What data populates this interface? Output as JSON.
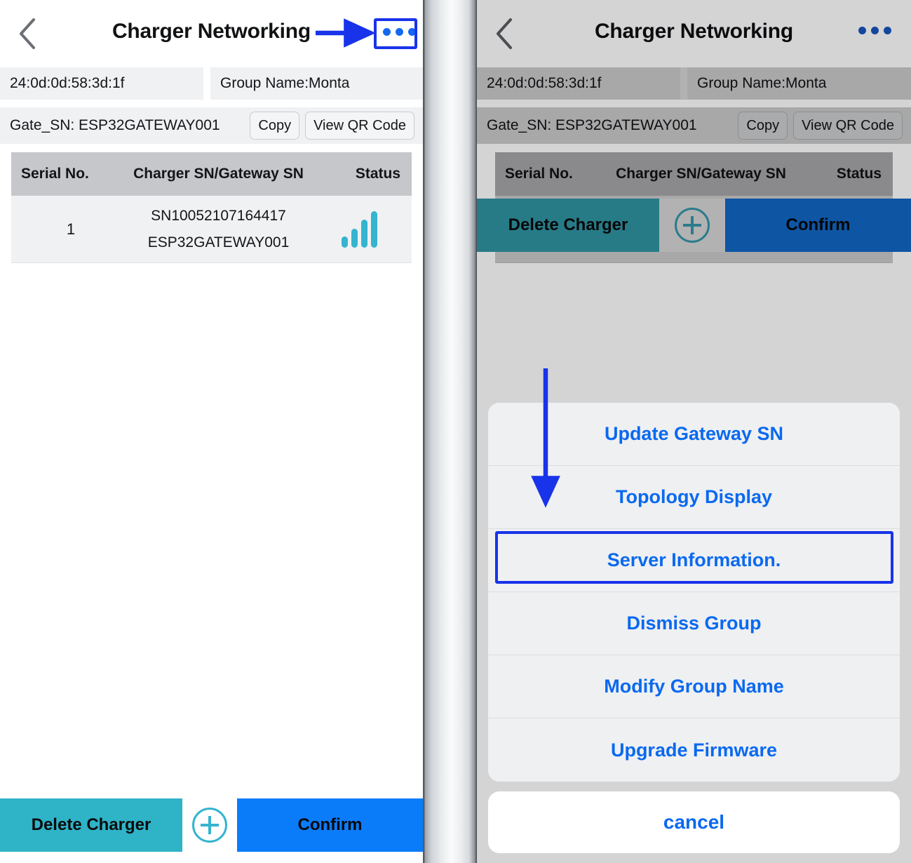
{
  "app": {
    "title": "Charger Networking",
    "back_icon": "chevron-left-icon",
    "more_icon": "ellipsis-icon"
  },
  "device": {
    "mac_address": "24:0d:0d:58:3d:1f",
    "group_name": "Group Name:Monta",
    "gateway_label": "Gate_SN:  ESP32GATEWAY001",
    "copy_label": "Copy",
    "qr_label": "View QR Code"
  },
  "table": {
    "headers": {
      "serial": "Serial No.",
      "sn": "Charger SN/Gateway SN",
      "status": "Status"
    },
    "rows": [
      {
        "serial": "1",
        "charger_sn": "SN10052107164417",
        "gateway_sn": "ESP32GATEWAY001",
        "status_icon": "signal-bars-icon",
        "status_bars": 4
      }
    ]
  },
  "bottom_bar": {
    "delete_label": "Delete Charger",
    "add_icon": "plus-circle-icon",
    "confirm_label": "Confirm"
  },
  "action_sheet": {
    "items": [
      {
        "label": "Update Gateway SN",
        "highlighted": false
      },
      {
        "label": "Topology Display",
        "highlighted": false
      },
      {
        "label": "Server Information.",
        "highlighted": true
      },
      {
        "label": "Dismiss Group",
        "highlighted": false
      },
      {
        "label": "Modify Group Name",
        "highlighted": false
      },
      {
        "label": "Upgrade Firmware",
        "highlighted": false
      }
    ],
    "cancel_label": "cancel"
  },
  "colors": {
    "accent_blue": "#0a69f0",
    "annotation_blue": "#1833ea",
    "delete_teal": "#2fb3c7",
    "confirm_blue": "#0a7cfa",
    "signal_teal": "#35b4cf",
    "table_header_gray": "#c5c7ca",
    "field_gray": "#f0f1f3"
  }
}
